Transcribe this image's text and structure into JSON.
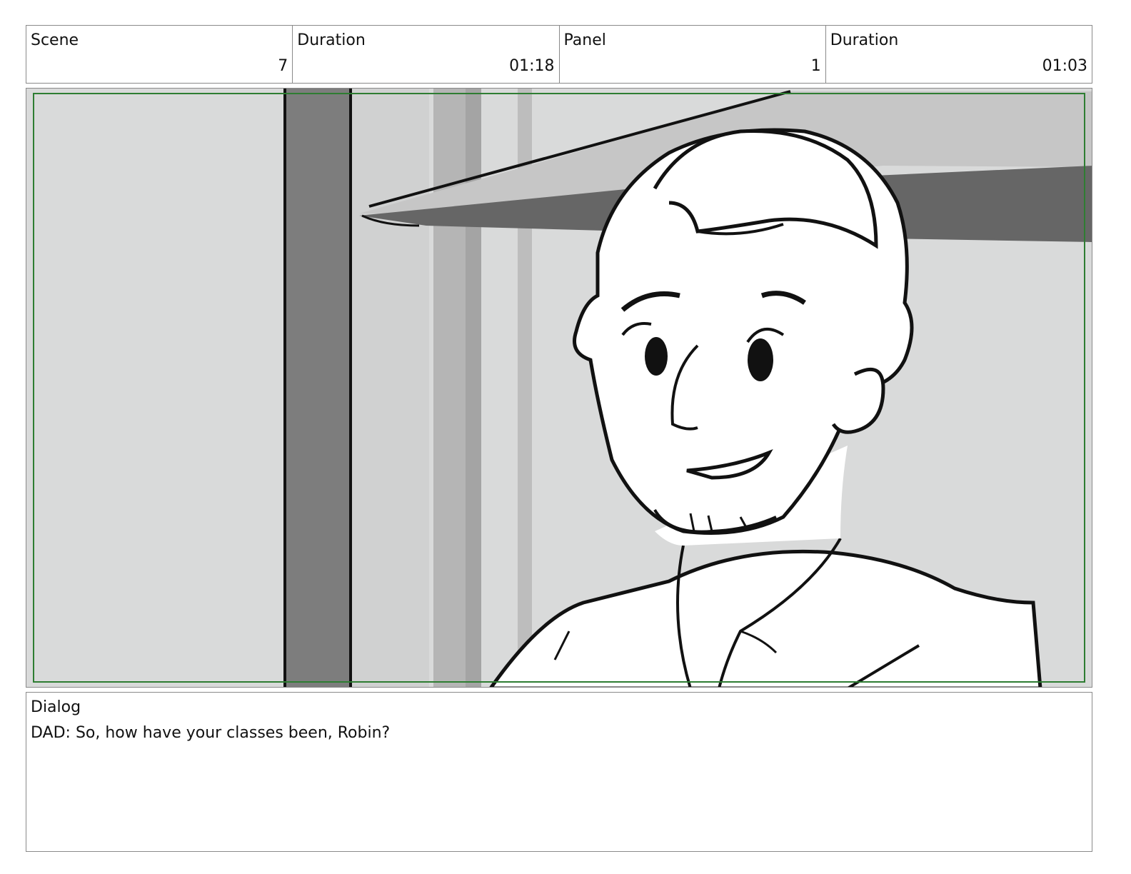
{
  "header": {
    "scene_label": "Scene",
    "scene_value": "7",
    "scene_duration_label": "Duration",
    "scene_duration_value": "01:18",
    "panel_label": "Panel",
    "panel_value": "1",
    "panel_duration_label": "Duration",
    "panel_duration_value": "01:03"
  },
  "dialog": {
    "label": "Dialog",
    "text": "DAD: So, how have your classes been, Robin?"
  },
  "colors": {
    "safe_frame": "#2e7d32",
    "background_wall": "#d8d9d9",
    "pillar": "#7a7a7a",
    "ink": "#111111"
  }
}
